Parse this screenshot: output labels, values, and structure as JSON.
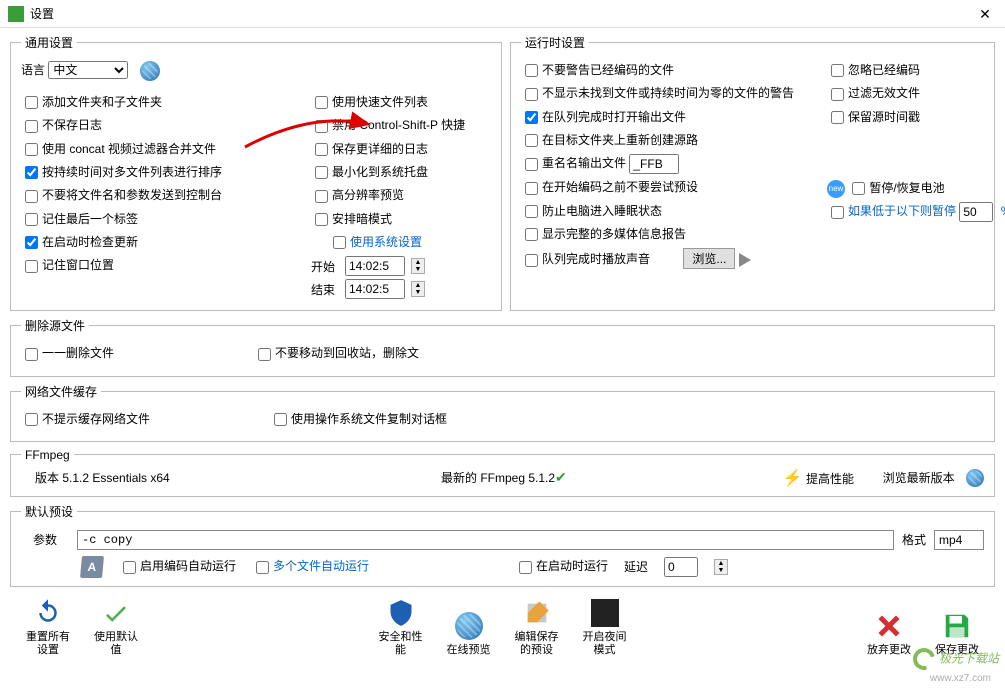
{
  "window": {
    "title": "设置"
  },
  "general": {
    "legend": "通用设置",
    "lang_label": "语言",
    "lang_value": "中文",
    "c1": {
      "add_sub": "添加文件夹和子文件夹",
      "no_log": "不保存日志",
      "use_concat": "使用 concat 视频过滤器合并文件",
      "sort_dur": "按持续时间对多文件列表进行排序",
      "no_send": "不要将文件名和参数发送到控制台",
      "last_tab": "记住最后一个标签",
      "check_upd": "在启动时检查更新",
      "win_pos": "记住窗口位置"
    },
    "c2": {
      "fast_list": "使用快速文件列表",
      "disable_csp": "禁用 Control-Shift-P 快捷",
      "detailed_log": "保存更详细的日志",
      "min_tray": "最小化到系统托盘",
      "hidpi": "高分辨率预览",
      "dark": "安排暗模式",
      "sys_set": "使用系统设置",
      "start_lbl": "开始",
      "end_lbl": "结束",
      "start_val": "14:02:5",
      "end_val": "14:02:5"
    }
  },
  "runtime": {
    "legend": "运行时设置",
    "l": {
      "no_warn": "不要警告已经编码的文件",
      "no_show_zero": "不显示未找到文件或持续时间为零的文件的警告",
      "open_after": "在队列完成时打开输出文件",
      "recreate_src": "在目标文件夹上重新创建源路",
      "rename_out": "重名名输出文件",
      "rename_val": "_FFB",
      "no_try_preset": "在开始编码之前不要尝试预设",
      "prevent_sleep": "防止电脑进入睡眠状态",
      "show_full": "显示完整的多媒体信息报告",
      "play_done": "队列完成时播放声音",
      "browse": "浏览..."
    },
    "r": {
      "ignore_enc": "忽略已经编码",
      "filter_invalid": "过滤无效文件",
      "keep_ts": "保留源时间戳",
      "pause_batt": "暂停/恢复电池",
      "pause_below": "如果低于以下则暂停",
      "pause_val": "50",
      "pct": "%"
    }
  },
  "del": {
    "legend": "删除源文件",
    "one_by_one": "一一删除文件",
    "no_recycle": "不要移动到回收站，删除文"
  },
  "net": {
    "legend": "网络文件缓存",
    "no_prompt": "不提示缓存网络文件",
    "use_os_copy": "使用操作系统文件复制对话框"
  },
  "ffmpeg": {
    "legend": "FFmpeg",
    "ver": "版本 5.1.2 Essentials  x64",
    "latest": "最新的 FFmpeg 5.1.2",
    "boost": "提高性能",
    "browse_latest": "浏览最新版本"
  },
  "preset": {
    "legend": "默认预设",
    "param_lbl": "参数",
    "param_val": "-c copy",
    "fmt_lbl": "格式",
    "fmt_val": "mp4",
    "auto_run": "启用编码自动运行",
    "multi_auto": "多个文件自动运行",
    "run_on_start": "在启动时运行",
    "delay_lbl": "延迟",
    "delay_val": "0"
  },
  "buttons": {
    "reset": "重置所有设置",
    "defaults": "使用默认值",
    "sec": "安全和性能",
    "online_pre": "在线预览",
    "edit_save": "编辑保存的预设",
    "night": "开启夜间模式",
    "discard": "放弃更改",
    "save": "保存更改"
  },
  "watermark": "极光下载站",
  "watermark_url": "www.xz7.com"
}
